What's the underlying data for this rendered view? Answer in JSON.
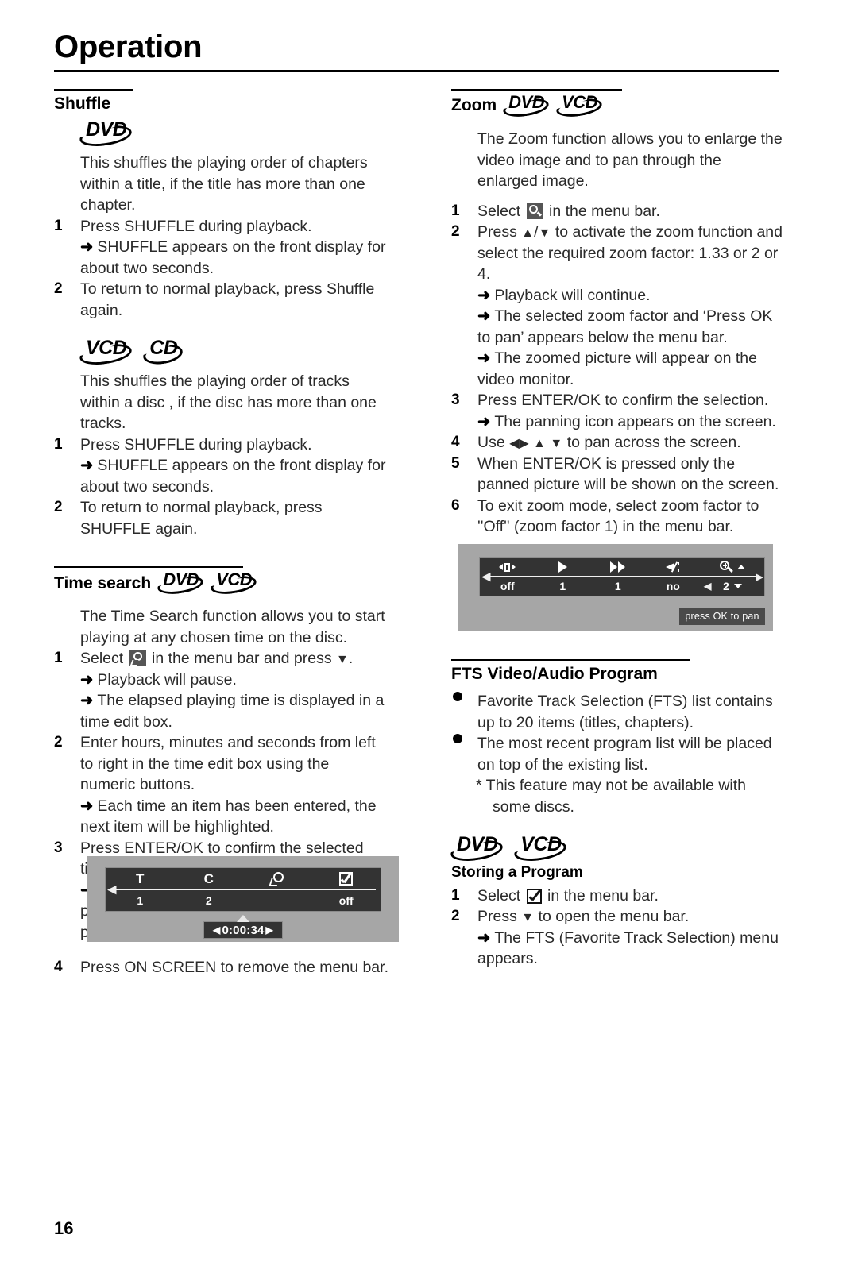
{
  "page": {
    "title": "Operation",
    "number": "16"
  },
  "left_column": {
    "shuffle": {
      "heading": "Shuffle",
      "dvd_logo": "DVD",
      "dvd_intro": "This shuffles the playing order of chapters within a title, if the title has more than one chapter.",
      "dvd_steps": [
        {
          "num": "1",
          "text": "Press SHUFFLE during playback."
        },
        {
          "num": "2",
          "text": "To return to normal playback, press Shuffle again."
        }
      ],
      "dvd_arrow": "SHUFFLE appears on the front display for about two seconds.",
      "vcd_logo": "VCD",
      "cd_logo": "CD",
      "vcd_intro": "This shuffles the playing order of tracks within a disc , if the disc has more than one tracks.",
      "vcd_steps": [
        {
          "num": "1",
          "text": "Press SHUFFLE during playback."
        },
        {
          "num": "2",
          "text": "To return to normal playback, press SHUFFLE again."
        }
      ],
      "vcd_arrow": "SHUFFLE appears on the front display for about two seconds."
    },
    "time_search": {
      "heading": "Time search",
      "logo_dvd": "DVD",
      "logo_vcd": "VCD",
      "intro": "The Time Search function allows you to start playing at any chosen time on the disc.",
      "step1_pre": "Select",
      "step1_icon": "clock-icon",
      "step1_post": "in the menu bar and press",
      "step1_arrow1": "Playback will pause.",
      "step1_arrow2": "The elapsed playing time is displayed in a time edit box.",
      "step2": "Enter hours, minutes and seconds from left to right in the time edit box using the numeric buttons.",
      "step2_arrow": "Each time an item has been entered, the next item will be highlighted.",
      "step3": "Press ENTER/OK to confirm the selected time.",
      "step3_arrow": "The time edit box will disappear and playback starts from the selected time position on the disc.",
      "step4": "Press ON SCREEN to remove the menu bar.",
      "nums": [
        "1",
        "2",
        "3",
        "4"
      ]
    },
    "figure_menu_bar": {
      "icons": [
        "T",
        "C",
        "clock-icon",
        "check-icon"
      ],
      "values": [
        "1",
        "2",
        "",
        "off"
      ],
      "time_value": "0:00:34"
    }
  },
  "right_column": {
    "zoom": {
      "heading": "Zoom",
      "logo_dvd": "DVD",
      "logo_vcd": "VCD",
      "intro": "The Zoom function allows you to enlarge the video image and to pan through the enlarged image.",
      "nums": [
        "1",
        "2",
        "3",
        "4",
        "5",
        "6"
      ],
      "step1_pre": "Select",
      "step1_icon": "magnifier-icon",
      "step1_post": "in the menu bar.",
      "step2_a": "Press",
      "step2_b": "to activate the zoom function and select the required zoom factor: 1.33 or 2 or 4.",
      "step2_arrow1": "Playback will continue.",
      "step2_arrow2": "The selected zoom factor and ‘Press OK to pan’ appears below the menu bar.",
      "step2_arrow3": "The zoomed picture will appear on the video monitor.",
      "step3": "Press ENTER/OK to confirm the selection.",
      "step3_arrow": "The panning icon appears on the screen.",
      "step4_a": "Use",
      "step4_b": "to pan across the screen.",
      "step5": "When ENTER/OK is pressed only the panned picture will be shown on the screen.",
      "step6": "To exit zoom mode, select zoom factor to ''Off'' (zoom factor 1) in the menu bar."
    },
    "figure_zoom_bar": {
      "icons": [
        "sound-mode-icon",
        "play-icon",
        "fast-forward-icon",
        "angle-icon",
        "magnifier-icon"
      ],
      "values": [
        "off",
        "1",
        "1",
        "no",
        "2"
      ],
      "pan_hint": "press OK to pan"
    },
    "fts": {
      "heading": "FTS Video/Audio Program",
      "bullets": [
        "Favorite Track Selection (FTS) list contains up to 20 items (titles, chapters).",
        "The most recent program list will be placed on top of the existing list."
      ],
      "note": "This feature may not be available with some discs.",
      "note_marker": "*",
      "logo_dvd": "DVD",
      "logo_vcd": "VCD",
      "sub_heading": "Storing a Program",
      "nums": [
        "1",
        "2"
      ],
      "step1_pre": "Select",
      "step1_icon": "check-icon",
      "step1_post": "in the menu bar.",
      "step2_pre": "Press",
      "step2_post": "to open the menu bar.",
      "step2_arrow": "The FTS (Favorite Track Selection) menu appears."
    }
  },
  "glyphs": {
    "arrow": "➜",
    "tri_down": "▼",
    "tri_up": "▲",
    "tri_left": "◀",
    "tri_right": "▶",
    "slash": "/"
  }
}
